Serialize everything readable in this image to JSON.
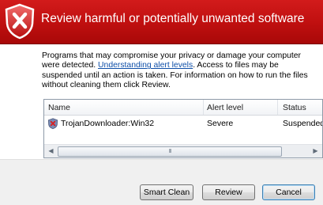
{
  "banner": {
    "title": "Review harmful or potentially unwanted software",
    "icon": "shield-x-icon"
  },
  "description": {
    "text_before_link": "Programs that may compromise your privacy or damage your computer were detected. ",
    "link_text": "Understanding alert levels",
    "text_after_link": ". Access to files may be suspended until an action is taken. For information on how to run the files without cleaning them click Review."
  },
  "table": {
    "columns": [
      "Name",
      "Alert level",
      "Status"
    ],
    "rows": [
      {
        "name": "TrojanDownloader:Win32",
        "alert_level": "Severe",
        "status": "Suspended",
        "icon": "threat-shield-icon"
      }
    ],
    "scrollbar": {
      "grip": "III"
    }
  },
  "buttons": {
    "smart_clean": "Smart Clean",
    "review": "Review",
    "cancel": "Cancel"
  },
  "colors": {
    "banner": "#c11010",
    "link": "#0f4fa8"
  }
}
